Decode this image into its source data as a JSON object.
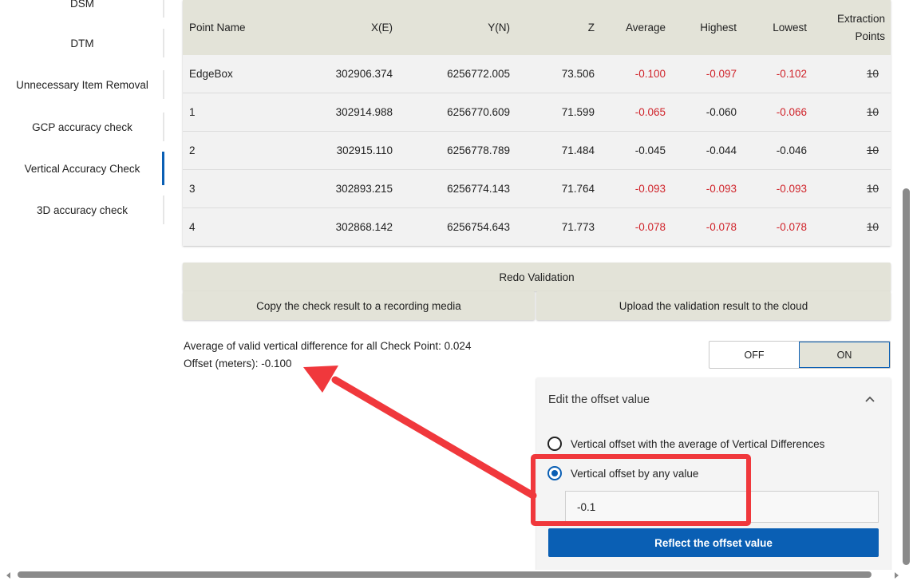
{
  "sidebar": {
    "items": [
      {
        "label": "DSM",
        "active": false
      },
      {
        "label": "DTM",
        "active": false
      },
      {
        "label": "Unnecessary Item Removal",
        "active": false
      },
      {
        "label": "GCP accuracy check",
        "active": false
      },
      {
        "label": "Vertical Accuracy Check",
        "active": true
      },
      {
        "label": "3D accuracy check",
        "active": false
      }
    ]
  },
  "table": {
    "headers": {
      "name": "Point Name",
      "x": "X(E)",
      "y": "Y(N)",
      "z": "Z",
      "avg": "Average",
      "high": "Highest",
      "low": "Lowest",
      "ext1": "Extraction",
      "ext2": "Points"
    },
    "rows": [
      {
        "name": "EdgeBox",
        "x": "302906.374",
        "y": "6256772.005",
        "z": "73.506",
        "avg": "-0.100",
        "high": "-0.097",
        "low": "-0.102",
        "ext": "10"
      },
      {
        "name": "1",
        "x": "302914.988",
        "y": "6256770.609",
        "z": "71.599",
        "avg": "-0.065",
        "high": "-0.060",
        "low": "-0.066",
        "ext": "10"
      },
      {
        "name": "2",
        "x": "302915.110",
        "y": "6256778.789",
        "z": "71.484",
        "avg": "-0.045",
        "high": "-0.044",
        "low": "-0.046",
        "ext": "10"
      },
      {
        "name": "3",
        "x": "302893.215",
        "y": "6256774.143",
        "z": "71.764",
        "avg": "-0.093",
        "high": "-0.093",
        "low": "-0.093",
        "ext": "10"
      },
      {
        "name": "4",
        "x": "302868.142",
        "y": "6256754.643",
        "z": "71.773",
        "avg": "-0.078",
        "high": "-0.078",
        "low": "-0.078",
        "ext": "10"
      }
    ]
  },
  "actions": {
    "redo": "Redo Validation",
    "copy": "Copy the check result to a recording media",
    "upload": "Upload the validation result to the cloud"
  },
  "summary": {
    "average_line": "Average of valid vertical difference for all Check Point: 0.024",
    "offset_line": "Offset (meters): -0.100"
  },
  "toggle": {
    "off": "OFF",
    "on": "ON",
    "selected": "ON"
  },
  "offset_panel": {
    "title": "Edit the offset value",
    "option_average": "Vertical offset with the average of Vertical Differences",
    "option_any": "Vertical offset by any value",
    "selected_option": "any",
    "value": "-0.1",
    "apply": "Reflect the offset value"
  },
  "colors": {
    "accent": "#0a5fb4",
    "negative": "#d0242b",
    "button_bg": "#e3e3d8",
    "annotation": "#f0383c"
  }
}
